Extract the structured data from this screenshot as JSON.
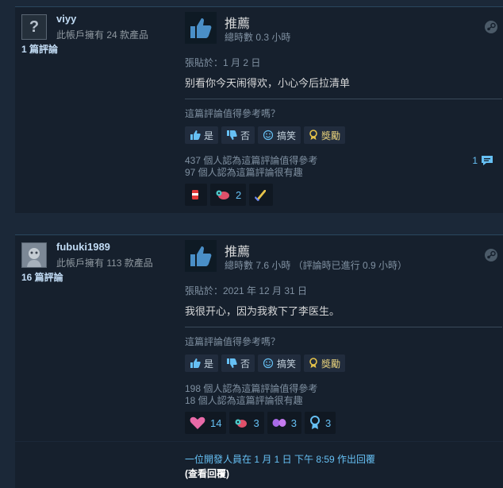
{
  "reviews": [
    {
      "username": "viyy",
      "products_owned": "此帳戶擁有 24 款產品",
      "review_count": "1 篇評論",
      "recommendation": "推薦",
      "hours": "總時數 0.3 小時",
      "posted": "張貼於：1 月 2 日",
      "content": "别看你今天闹得欢，小心今后拉清单",
      "helpful_question": "這篇評論值得參考嗎？",
      "buttons": {
        "yes": "是",
        "no": "否",
        "funny": "搞笑",
        "award": "獎勵"
      },
      "helpful_stats": "437 個人認為這篇評論值得參考",
      "funny_stats": "97 個人認為這篇評論很有趣",
      "comment_count": "1",
      "awards": [
        {
          "icon": "soda-can-icon",
          "count": ""
        },
        {
          "icon": "critter-icon",
          "count": "2"
        },
        {
          "icon": "sword-icon",
          "count": ""
        }
      ]
    },
    {
      "username": "fubuki1989",
      "products_owned": "此帳戶擁有 113 款產品",
      "review_count": "16 篇評論",
      "recommendation": "推薦",
      "hours": "總時數 7.6 小時 （評論時已進行 0.9 小時）",
      "posted": "張貼於：2021 年 12 月 31 日",
      "content": "我很开心，因为我救下了李医生。",
      "helpful_question": "這篇評論值得參考嗎？",
      "buttons": {
        "yes": "是",
        "no": "否",
        "funny": "搞笑",
        "award": "獎勵"
      },
      "helpful_stats": "198 個人認為這篇評論值得參考",
      "funny_stats": "18 個人認為這篇評論很有趣",
      "comment_count": "",
      "awards": [
        {
          "icon": "heart-icon",
          "count": "14"
        },
        {
          "icon": "critter-icon",
          "count": "3"
        },
        {
          "icon": "butterfly-icon",
          "count": "3"
        },
        {
          "icon": "medal-icon",
          "count": "3"
        }
      ]
    }
  ],
  "developer_reply": {
    "text": "一位開發人員在 1 月 1 日 下午 8:59 作出回覆",
    "link": "(查看回覆)"
  },
  "colors": {
    "background": "#1b2838",
    "panel": "#16202d",
    "accent": "#66c0f4",
    "thumb": "#4a8fc7"
  }
}
